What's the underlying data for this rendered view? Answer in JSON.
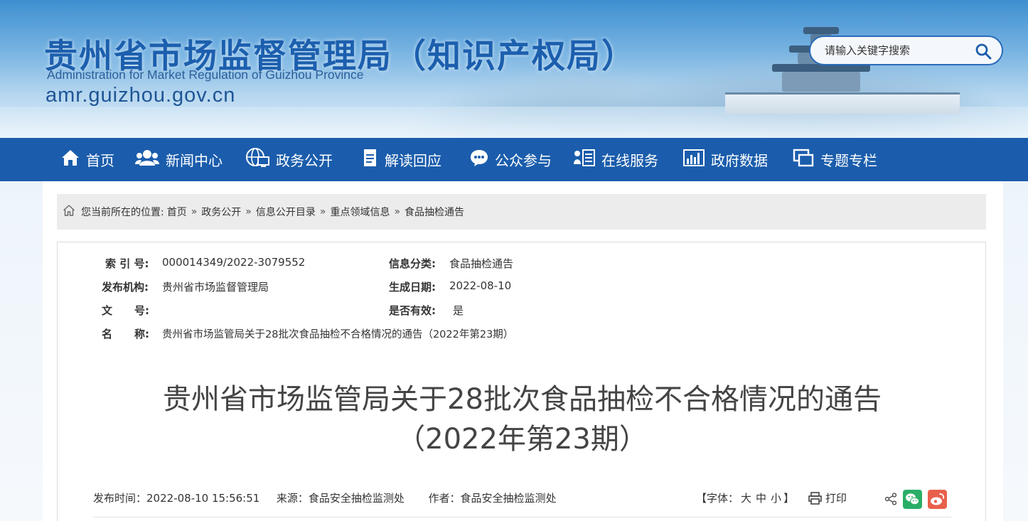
{
  "header": {
    "title": "贵州省市场监督管理局（知识产权局）",
    "title_en": "Administration for Market Regulation of Guizhou Province",
    "domain": "amr.guizhou.gov.cn",
    "search_placeholder": "请输入关键字搜索",
    "accent_color": "#1b5dac"
  },
  "nav": {
    "items": [
      {
        "label": "首页",
        "icon": "home-icon"
      },
      {
        "label": "新闻中心",
        "icon": "users-icon"
      },
      {
        "label": "政务公开",
        "icon": "globe-monitor-icon"
      },
      {
        "label": "解读回应",
        "icon": "document-icon"
      },
      {
        "label": "公众参与",
        "icon": "chat-bubble-icon"
      },
      {
        "label": "在线服务",
        "icon": "person-list-icon"
      },
      {
        "label": "政府数据",
        "icon": "bar-chart-icon"
      },
      {
        "label": "专题专栏",
        "icon": "windows-icon"
      }
    ]
  },
  "breadcrumb": {
    "prefix": "您当前所在的位置:",
    "separator": "»",
    "items": [
      "首页",
      "政务公开",
      "信息公开目录",
      "重点领域信息",
      "食品抽检通告"
    ]
  },
  "meta": {
    "index_label": "索 引 号:",
    "index_value": "000014349/2022-3079552",
    "category_label": "信息分类:",
    "category_value": "食品抽检通告",
    "publisher_label": "发布机构:",
    "publisher_value": "贵州省市场监督管理局",
    "date_label": "生成日期:",
    "date_value": "2022-08-10",
    "docno_label_1": "文",
    "docno_label_2": "号:",
    "docno_value": "",
    "valid_label": "是否有效:",
    "valid_value": "是",
    "name_label_1": "名",
    "name_label_2": "称:",
    "name_value": "贵州省市场监管局关于28批次食品抽检不合格情况的通告（2022年第23期）"
  },
  "article": {
    "title_line1": "贵州省市场监管局关于28批次食品抽检不合格情况的通告",
    "title_line2": "（2022年第23期）",
    "publish_time_label": "发布时间：",
    "publish_time": "2022-08-10 15:56:51",
    "source_label": "来源：",
    "source": "食品安全抽检监测处",
    "author_label": "作者：",
    "author": "食品安全抽检监测处",
    "font_open": "【字体：",
    "font_large": "大",
    "font_medium": "中",
    "font_small": "小",
    "font_close": "】",
    "print_label": "打印",
    "share_icons": [
      "share-icon",
      "wechat-icon",
      "weibo-icon"
    ],
    "wechat_color": "#2aae67",
    "weibo_color": "#e8604c"
  }
}
